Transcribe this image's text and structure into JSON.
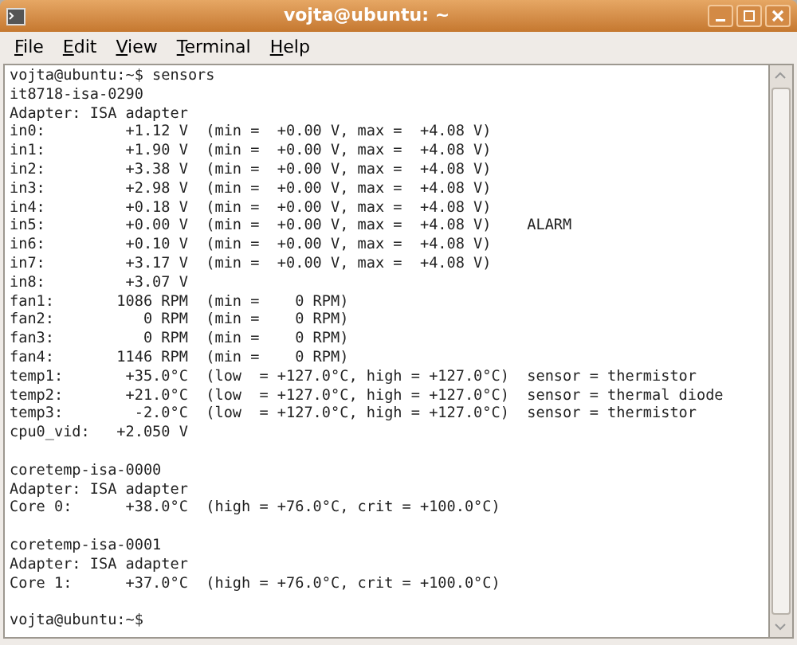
{
  "window": {
    "title": "vojta@ubuntu: ~"
  },
  "menu": [
    "File",
    "Edit",
    "View",
    "Terminal",
    "Help"
  ],
  "terminal": {
    "blocks": [
      {
        "lines": [
          "vojta@ubuntu:~$ sensors",
          "it8718-isa-0290",
          "Adapter: ISA adapter",
          "in0:         +1.12 V  (min =  +0.00 V, max =  +4.08 V)",
          "in1:         +1.90 V  (min =  +0.00 V, max =  +4.08 V)",
          "in2:         +3.38 V  (min =  +0.00 V, max =  +4.08 V)",
          "in3:         +2.98 V  (min =  +0.00 V, max =  +4.08 V)",
          "in4:         +0.18 V  (min =  +0.00 V, max =  +4.08 V)",
          "in5:         +0.00 V  (min =  +0.00 V, max =  +4.08 V)    ALARM",
          "in6:         +0.10 V  (min =  +0.00 V, max =  +4.08 V)",
          "in7:         +3.17 V  (min =  +0.00 V, max =  +4.08 V)",
          "in8:         +3.07 V",
          "fan1:       1086 RPM  (min =    0 RPM)",
          "fan2:          0 RPM  (min =    0 RPM)",
          "fan3:          0 RPM  (min =    0 RPM)",
          "fan4:       1146 RPM  (min =    0 RPM)",
          "temp1:       +35.0°C  (low  = +127.0°C, high = +127.0°C)  sensor = thermistor",
          "temp2:       +21.0°C  (low  = +127.0°C, high = +127.0°C)  sensor = thermal diode",
          "temp3:        -2.0°C  (low  = +127.0°C, high = +127.0°C)  sensor = thermistor",
          "cpu0_vid:   +2.050 V"
        ]
      },
      {
        "lines": [
          "coretemp-isa-0000",
          "Adapter: ISA adapter",
          "Core 0:      +38.0°C  (high = +76.0°C, crit = +100.0°C)"
        ]
      },
      {
        "lines": [
          "coretemp-isa-0001",
          "Adapter: ISA adapter",
          "Core 1:      +37.0°C  (high = +76.0°C, crit = +100.0°C)"
        ]
      },
      {
        "lines": [
          "vojta@ubuntu:~$"
        ]
      }
    ]
  }
}
